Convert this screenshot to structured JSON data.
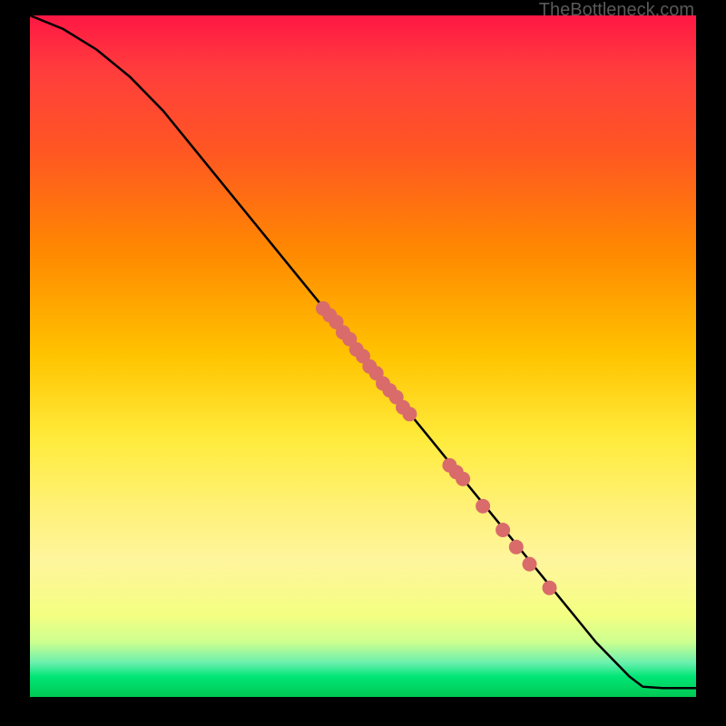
{
  "watermark": "TheBottleneck.com",
  "chart_data": {
    "type": "line",
    "title": "",
    "xlabel": "",
    "ylabel": "",
    "xlim": [
      0,
      100
    ],
    "ylim": [
      0,
      100
    ],
    "curve": {
      "x": [
        0,
        5,
        10,
        15,
        20,
        25,
        30,
        35,
        40,
        45,
        50,
        55,
        60,
        65,
        70,
        75,
        80,
        85,
        90,
        92,
        95,
        100
      ],
      "y": [
        100,
        98,
        95,
        91,
        86,
        80,
        74,
        68,
        62,
        56,
        50,
        44,
        38,
        32,
        26,
        20,
        14,
        8,
        3,
        1.5,
        1.3,
        1.3
      ]
    },
    "points": [
      {
        "x": 44,
        "y": 57
      },
      {
        "x": 45,
        "y": 56
      },
      {
        "x": 46,
        "y": 55
      },
      {
        "x": 47,
        "y": 53.5
      },
      {
        "x": 48,
        "y": 52.5
      },
      {
        "x": 49,
        "y": 51
      },
      {
        "x": 50,
        "y": 50
      },
      {
        "x": 51,
        "y": 48.5
      },
      {
        "x": 52,
        "y": 47.5
      },
      {
        "x": 53,
        "y": 46
      },
      {
        "x": 54,
        "y": 45
      },
      {
        "x": 55,
        "y": 44
      },
      {
        "x": 56,
        "y": 42.5
      },
      {
        "x": 57,
        "y": 41.5
      },
      {
        "x": 63,
        "y": 34
      },
      {
        "x": 64,
        "y": 33
      },
      {
        "x": 65,
        "y": 32
      },
      {
        "x": 68,
        "y": 28
      },
      {
        "x": 71,
        "y": 24.5
      },
      {
        "x": 73,
        "y": 22
      },
      {
        "x": 75,
        "y": 19.5
      },
      {
        "x": 78,
        "y": 16
      }
    ]
  }
}
